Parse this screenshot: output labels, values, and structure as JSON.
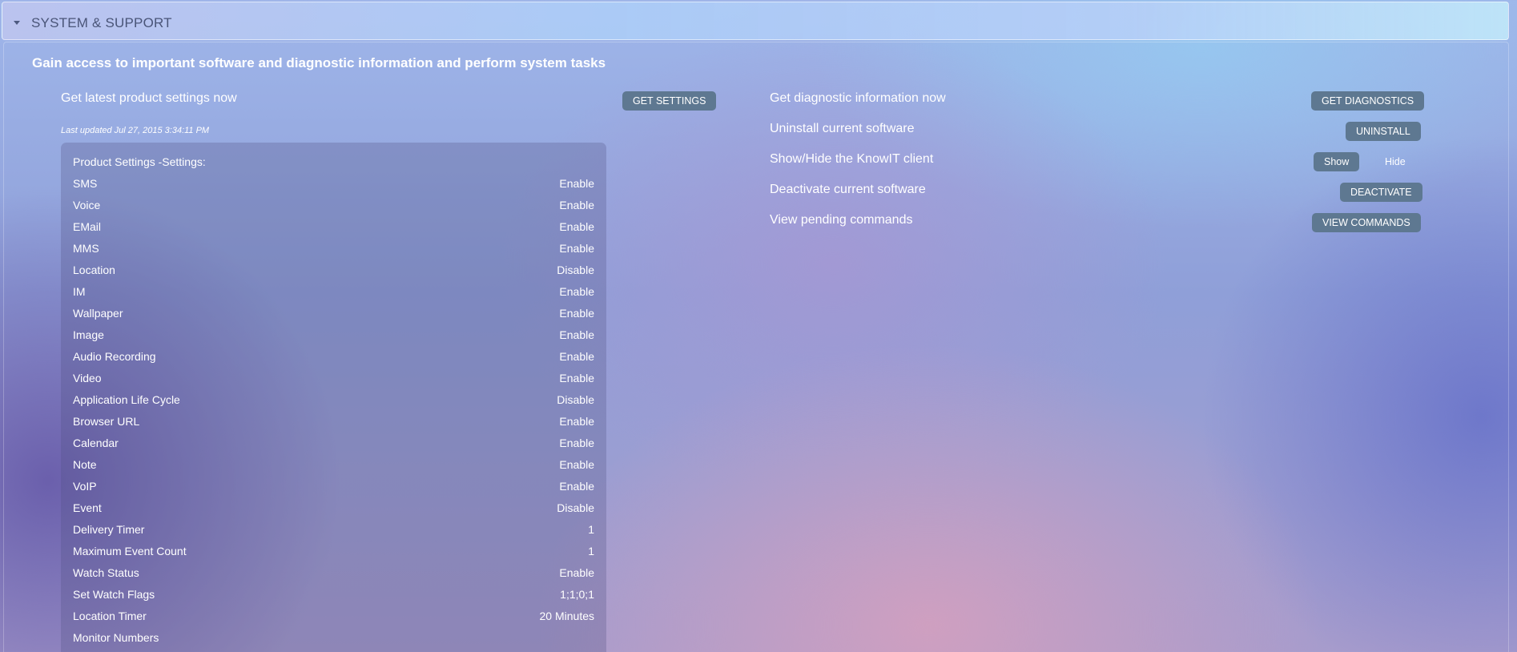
{
  "section": {
    "title": "SYSTEM & SUPPORT",
    "intro": "Gain access to important software and diagnostic information and perform system tasks"
  },
  "left_panel": {
    "settings_label": "Get latest product settings now",
    "settings_button": "GET SETTINGS",
    "last_updated": "Last updated Jul 27, 2015 3:34:11 PM",
    "settings_title": "Product Settings -Settings:",
    "settings": [
      {
        "name": "SMS",
        "value": "Enable"
      },
      {
        "name": "Voice",
        "value": "Enable"
      },
      {
        "name": "EMail",
        "value": "Enable"
      },
      {
        "name": "MMS",
        "value": "Enable"
      },
      {
        "name": "Location",
        "value": "Disable"
      },
      {
        "name": "IM",
        "value": "Enable"
      },
      {
        "name": "Wallpaper",
        "value": "Enable"
      },
      {
        "name": "Image",
        "value": "Enable"
      },
      {
        "name": "Audio Recording",
        "value": "Enable"
      },
      {
        "name": "Video",
        "value": "Enable"
      },
      {
        "name": "Application Life Cycle",
        "value": "Disable"
      },
      {
        "name": "Browser URL",
        "value": "Enable"
      },
      {
        "name": "Calendar",
        "value": "Enable"
      },
      {
        "name": "Note",
        "value": "Enable"
      },
      {
        "name": "VoIP",
        "value": "Enable"
      },
      {
        "name": "Event",
        "value": "Disable"
      },
      {
        "name": "Delivery Timer",
        "value": "1"
      },
      {
        "name": "Maximum Event Count",
        "value": "1"
      },
      {
        "name": "Watch Status",
        "value": "Enable"
      },
      {
        "name": "Set Watch Flags",
        "value": "1;1;0;1"
      },
      {
        "name": "Location Timer",
        "value": "20 Minutes"
      },
      {
        "name": "Monitor Numbers",
        "value": ""
      }
    ]
  },
  "right_panel": {
    "diagnostics_label": "Get diagnostic information now",
    "diagnostics_button": "GET DIAGNOSTICS",
    "uninstall_label": "Uninstall current software",
    "uninstall_button": "UNINSTALL",
    "client_label": "Show/Hide the KnowIT client",
    "show_button": "Show",
    "hide_button": "Hide",
    "deactivate_label": "Deactivate current software",
    "deactivate_button": "DEACTIVATE",
    "commands_label": "View pending commands",
    "commands_button": "VIEW COMMANDS"
  }
}
